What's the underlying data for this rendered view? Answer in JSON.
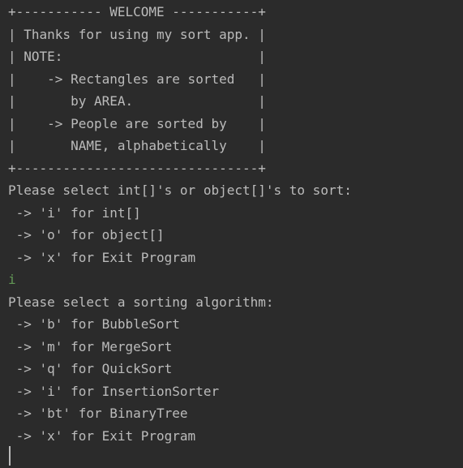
{
  "console": {
    "lines": [
      "+----------- WELCOME -----------+",
      "| Thanks for using my sort app. |",
      "| NOTE:                         |",
      "|    -> Rectangles are sorted   |",
      "|       by AREA.                |",
      "|    -> People are sorted by    |",
      "|       NAME, alphabetically    |",
      "+-------------------------------+",
      "Please select int[]'s or object[]'s to sort:",
      " -> 'i' for int[]",
      " -> 'o' for object[]",
      " -> 'x' for Exit Program",
      "i",
      "Please select a sorting algorithm:",
      " -> 'b' for BubbleSort",
      " -> 'm' for MergeSort",
      " -> 'q' for QuickSort",
      " -> 'i' for InsertionSorter",
      " -> 'bt' for BinaryTree",
      " -> 'x' for Exit Program"
    ],
    "colors": {
      "background": "#2b2b2b",
      "output_text": "#bbbbbb",
      "user_input": "#629755"
    }
  }
}
